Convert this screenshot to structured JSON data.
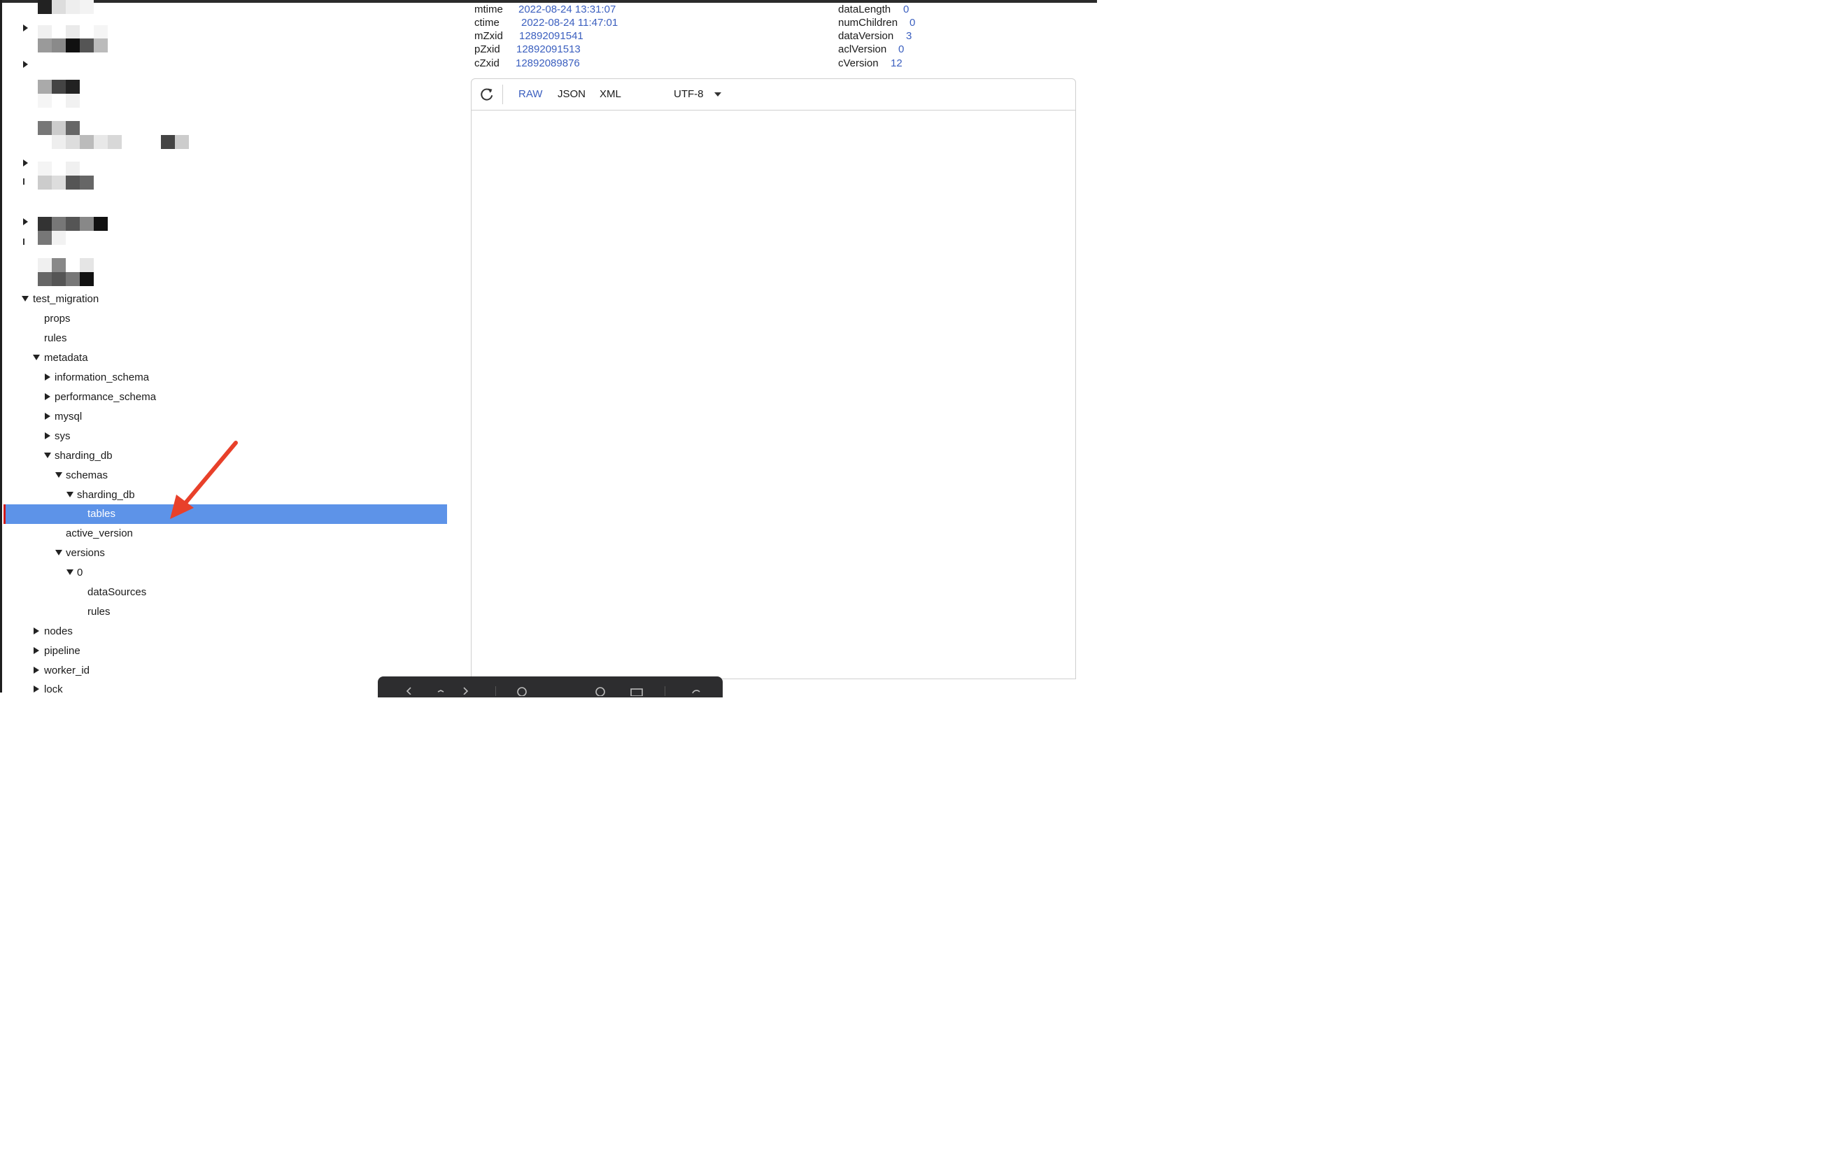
{
  "tree": {
    "nodes": [
      {
        "label": "test_migration",
        "state": "open",
        "level": 0
      },
      {
        "label": "props",
        "state": "leaf",
        "level": 1
      },
      {
        "label": "rules",
        "state": "leaf",
        "level": 1
      },
      {
        "label": "metadata",
        "state": "open",
        "level": 1
      },
      {
        "label": "information_schema",
        "state": "closed",
        "level": 2
      },
      {
        "label": "performance_schema",
        "state": "closed",
        "level": 2
      },
      {
        "label": "mysql",
        "state": "closed",
        "level": 2
      },
      {
        "label": "sys",
        "state": "closed",
        "level": 2
      },
      {
        "label": "sharding_db",
        "state": "open",
        "level": 2
      },
      {
        "label": "schemas",
        "state": "open",
        "level": 3
      },
      {
        "label": "sharding_db",
        "state": "open",
        "level": 4
      },
      {
        "label": "tables",
        "state": "leaf",
        "level": 5,
        "selected": true
      },
      {
        "label": "active_version",
        "state": "leaf",
        "level": 3
      },
      {
        "label": "versions",
        "state": "open",
        "level": 3
      },
      {
        "label": "0",
        "state": "open",
        "level": 4
      },
      {
        "label": "dataSources",
        "state": "leaf",
        "level": 5
      },
      {
        "label": "rules",
        "state": "leaf",
        "level": 5
      },
      {
        "label": "nodes",
        "state": "closed",
        "level": 1
      },
      {
        "label": "pipeline",
        "state": "closed",
        "level": 1
      },
      {
        "label": "worker_id",
        "state": "closed",
        "level": 1
      },
      {
        "label": "lock",
        "state": "closed",
        "level": 1
      }
    ]
  },
  "stats": {
    "left": [
      {
        "key": "mtime",
        "value": "2022-08-24 13:31:07"
      },
      {
        "key": "ctime",
        "value": "2022-08-24 11:47:01"
      },
      {
        "key": "mZxid",
        "value": "12892091541"
      },
      {
        "key": "pZxid",
        "value": "12892091513"
      },
      {
        "key": "cZxid",
        "value": "12892089876"
      }
    ],
    "right": [
      {
        "key": "dataLength",
        "value": "0"
      },
      {
        "key": "numChildren",
        "value": "0"
      },
      {
        "key": "dataVersion",
        "value": "3"
      },
      {
        "key": "aclVersion",
        "value": "0"
      },
      {
        "key": "cVersion",
        "value": "12"
      }
    ]
  },
  "editor": {
    "formats": [
      "RAW",
      "JSON",
      "XML"
    ],
    "active_format": "RAW",
    "encoding": "UTF-8",
    "content": ""
  },
  "colors": {
    "selection": "#5d93e8",
    "value_text": "#3b5fbf",
    "annotation_arrow": "#e8402a",
    "selection_marker": "#d11a1a"
  },
  "icons": [
    "refresh-icon",
    "dropdown-caret-icon",
    "annotation-arrow"
  ]
}
